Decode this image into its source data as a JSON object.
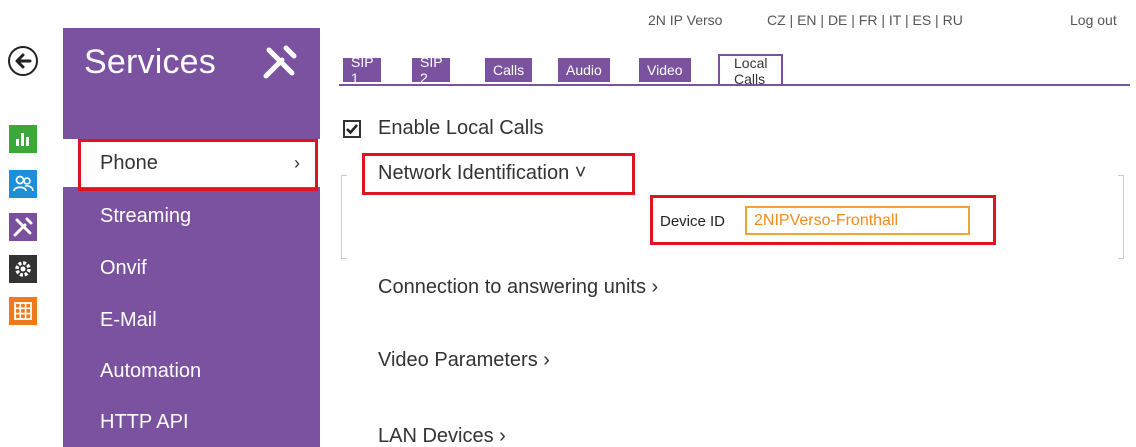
{
  "topbar": {
    "product": "2N IP Verso",
    "languages": "CZ | EN | DE | FR | IT | ES | RU",
    "logout": "Log out"
  },
  "icons": {
    "back": "back-arrow-icon",
    "strip": [
      "stats-icon",
      "users-icon",
      "services-icon",
      "settings-icon",
      "system-icon"
    ]
  },
  "sidebar": {
    "title": "Services",
    "items": [
      {
        "label": "Phone",
        "active": true,
        "chevron": "›"
      },
      {
        "label": "Streaming"
      },
      {
        "label": "Onvif"
      },
      {
        "label": "E-Mail"
      },
      {
        "label": "Automation"
      },
      {
        "label": "HTTP API"
      }
    ]
  },
  "tabs": [
    {
      "label": "SIP 1"
    },
    {
      "label": "SIP 2"
    },
    {
      "label": "Calls"
    },
    {
      "label": "Audio"
    },
    {
      "label": "Video"
    },
    {
      "label": "Local Calls",
      "active": true
    }
  ],
  "content": {
    "enable_label": "Enable Local Calls",
    "enable_checked": true,
    "network_identification": "Network Identification ˅",
    "device_id_label": "Device ID",
    "device_id_value": "2NIPVerso-Fronthall",
    "connection_section": "Connection to answering units ›",
    "video_section": "Video Parameters ›",
    "lan_section": "LAN Devices ›"
  },
  "colors": {
    "accent_purple": "#7b52a0",
    "highlight_red": "#e0141e",
    "input_orange": "#f0a33c"
  }
}
